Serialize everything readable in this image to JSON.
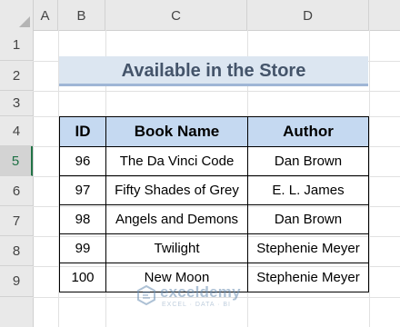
{
  "columns": [
    "A",
    "B",
    "C",
    "D"
  ],
  "rows": [
    "1",
    "2",
    "3",
    "4",
    "5",
    "6",
    "7",
    "8",
    "9"
  ],
  "active_row": "5",
  "title": "Available in the Store",
  "table": {
    "headers": [
      "ID",
      "Book Name",
      "Author"
    ],
    "rows": [
      [
        "96",
        "The Da Vinci Code",
        "Dan Brown"
      ],
      [
        "97",
        "Fifty Shades of Grey",
        "E. L. James"
      ],
      [
        "98",
        "Angels and Demons",
        "Dan Brown"
      ],
      [
        "99",
        "Twilight",
        "Stephenie Meyer"
      ],
      [
        "100",
        "New Moon",
        "Stephenie Meyer"
      ]
    ]
  },
  "watermark": {
    "name": "exceldemy",
    "tagline": "EXCEL · DATA · BI"
  },
  "colors": {
    "title_fill": "#dce6f1",
    "header_fill": "#c5d9f1",
    "title_text": "#44546a",
    "active_row_accent": "#217346"
  }
}
